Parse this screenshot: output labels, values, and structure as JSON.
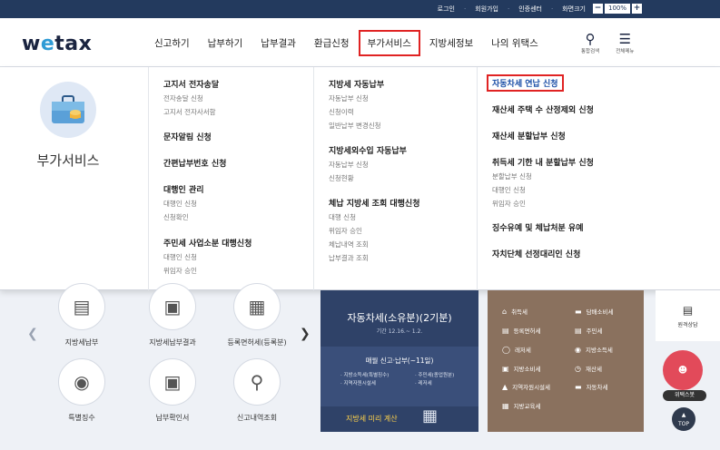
{
  "topbar": {
    "login": "로그인",
    "signup": "회원가입",
    "auth": "인증센터",
    "zoom_label": "화면크기",
    "zoom_minus": "−",
    "zoom_value": "100%",
    "zoom_plus": "+"
  },
  "logo": {
    "pre": "w",
    "e": "e",
    "post": "tax"
  },
  "gnb": [
    "신고하기",
    "납부하기",
    "납부결과",
    "환급신청",
    "부가서비스",
    "지방세정보",
    "나의 위택스"
  ],
  "tools": {
    "search": "통합검색",
    "menu": "전체메뉴"
  },
  "dropdown": {
    "title": "부가서비스",
    "col1": [
      {
        "title": "고지서 전자송달",
        "subs": [
          "전자송달 신청",
          "고지서 전자사서함"
        ]
      },
      {
        "title": "문자알림 신청",
        "subs": []
      },
      {
        "title": "간편납부번호 신청",
        "subs": []
      },
      {
        "title": "대행인 관리",
        "subs": [
          "대행인 신청",
          "신청확인"
        ]
      },
      {
        "title": "주민세 사업소분 대행신청",
        "subs": [
          "대행인 신청",
          "위임자 승인"
        ]
      }
    ],
    "col2": [
      {
        "title": "지방세 자동납부",
        "subs": [
          "자동납부 신청",
          "신청이력",
          "일반납부 변경신청"
        ]
      },
      {
        "title": "지방세외수입 자동납부",
        "subs": [
          "자동납부 신청",
          "신청현황"
        ]
      },
      {
        "title": "체납 지방세 조회 대행신청",
        "subs": [
          "대행 신청",
          "위임자 승인",
          "체납내역 조회",
          "납부결과 조회"
        ]
      }
    ],
    "col3": [
      {
        "title": "자동차세 연납 신청",
        "subs": []
      },
      {
        "title": "재산세 주택 수 산정제외 신청",
        "subs": []
      },
      {
        "title": "재산세 분할납부 신청",
        "subs": []
      },
      {
        "title": "취득세 기한 내 분할납부 신청",
        "subs": [
          "분할납부 신청",
          "대행인 신청",
          "위임자 승인"
        ]
      },
      {
        "title": "징수유예 및 체납처분 유예",
        "subs": []
      },
      {
        "title": "자치단체 선정대리인 신청",
        "subs": []
      }
    ]
  },
  "services": [
    "지방세납부",
    "지방세납부결과",
    "등록면허세(등록분)",
    "특별징수",
    "납부확인서",
    "신고내역조회"
  ],
  "banner": {
    "title": "자동차세(소유분)(2기분)",
    "date": "기간 12.16.~ 1.2.",
    "monthly": "매월 신고·납부(~11일)",
    "list1": [
      "· 지방소득세(특별징수)",
      "· 지역자원시설세"
    ],
    "list2": [
      "· 주민세(종업원분)",
      "· 레저세"
    ],
    "foot": "지방세 미리 계산"
  },
  "taxes": [
    "취득세",
    "등록면허세",
    "레저세",
    "지방소비세",
    "지역자원시설세",
    "지방교육세",
    "담배소비세",
    "주민세",
    "지방소득세",
    "재산세",
    "자동차세"
  ],
  "side": {
    "consult": "원격상담",
    "mascot": "위택스봇",
    "top": "TOP"
  }
}
